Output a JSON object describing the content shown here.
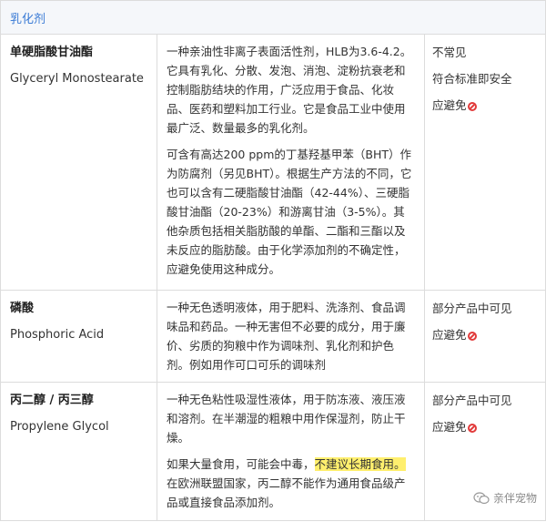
{
  "section": {
    "title": "乳化剂"
  },
  "rows": [
    {
      "name_zh": "单硬脂酸甘油酯",
      "name_en": "Glyceryl Monostearate",
      "desc": [
        "一种亲油性非离子表面活性剂，HLB为3.6-4.2。它具有乳化、分散、发泡、消泡、淀粉抗衰老和控制脂肪结块的作用，广泛应用于食品、化妆品、医药和塑料加工行业。它是食品工业中使用最广泛、数量最多的乳化剂。",
        "可含有高达200 ppm的丁基羟基甲苯（BHT）作为防腐剂（另见BHT）。根据生产方法的不同，它也可以含有二硬脂酸甘油酯（42-44%）、三硬脂酸甘油酯（20-23%）和游离甘油（3-5%）。其他杂质包括相关脂肪酸的单酯、二酯和三酯以及未反应的脂肪酸。由于化学添加剂的不确定性，应避免使用这种成分。"
      ],
      "status": [
        "不常见",
        "符合标准即安全",
        "应避免"
      ]
    },
    {
      "name_zh": "磷酸",
      "name_en": "Phosphoric Acid",
      "desc": [
        "一种无色透明液体，用于肥料、洗涤剂、食品调味品和药品。一种无害但不必要的成分，用于廉价、劣质的狗粮中作为调味剂、乳化剂和护色剂。例如用作可口可乐的调味剂"
      ],
      "status": [
        "部分产品中可见",
        "应避免"
      ]
    },
    {
      "name_zh": "丙二醇 / 丙三醇",
      "name_en": "Propylene Glycol",
      "desc": [
        "一种无色粘性吸湿性液体，用于防冻液、液压液和溶剂。在半潮湿的粗粮中用作保湿剂，防止干燥。"
      ],
      "desc2_pre": "如果大量食用，可能会中毒，",
      "desc2_hl": "不建议长期食用。",
      "desc2_post": "在欧洲联盟国家，丙二醇不能作为通用食品级产品或直接食品添加剂。",
      "status": [
        "部分产品中可见",
        "应避免"
      ]
    }
  ],
  "watermark": {
    "text": "亲伴宠物",
    "icon": "wechat-icon"
  },
  "colors": {
    "accent": "#3a7bd5",
    "highlight": "#ffef6e",
    "avoid": "#e23b3b"
  }
}
